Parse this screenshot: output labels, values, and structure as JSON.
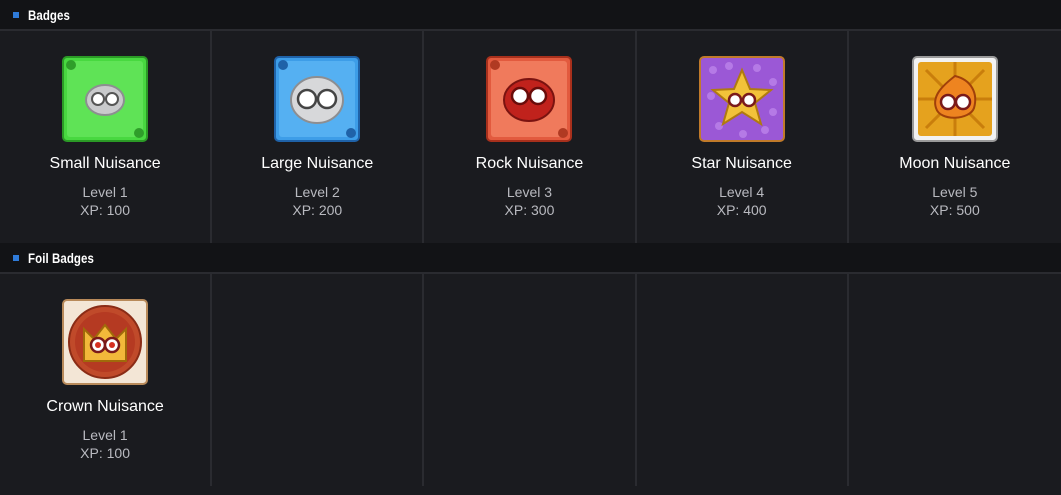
{
  "sections": [
    {
      "title": "Badges",
      "badges": [
        {
          "name": "Small Nuisance",
          "level": "Level 1",
          "xp": "XP: 100",
          "icon": "small-nuisance-badge-icon",
          "color": "#3fcf3a"
        },
        {
          "name": "Large Nuisance",
          "level": "Level 2",
          "xp": "XP: 200",
          "icon": "large-nuisance-badge-icon",
          "color": "#3a9ae6"
        },
        {
          "name": "Rock Nuisance",
          "level": "Level 3",
          "xp": "XP: 300",
          "icon": "rock-nuisance-badge-icon",
          "color": "#e0553a"
        },
        {
          "name": "Star Nuisance",
          "level": "Level 4",
          "xp": "XP: 400",
          "icon": "star-nuisance-badge-icon",
          "color": "#9a5ad8"
        },
        {
          "name": "Moon Nuisance",
          "level": "Level 5",
          "xp": "XP: 500",
          "icon": "moon-nuisance-badge-icon",
          "color": "#e0a020"
        }
      ]
    },
    {
      "title": "Foil Badges",
      "badges": [
        {
          "name": "Crown Nuisance",
          "level": "Level 1",
          "xp": "XP: 100",
          "icon": "crown-nuisance-badge-icon",
          "color": "#c8452a"
        }
      ]
    }
  ],
  "accent": "#2f7bd9"
}
